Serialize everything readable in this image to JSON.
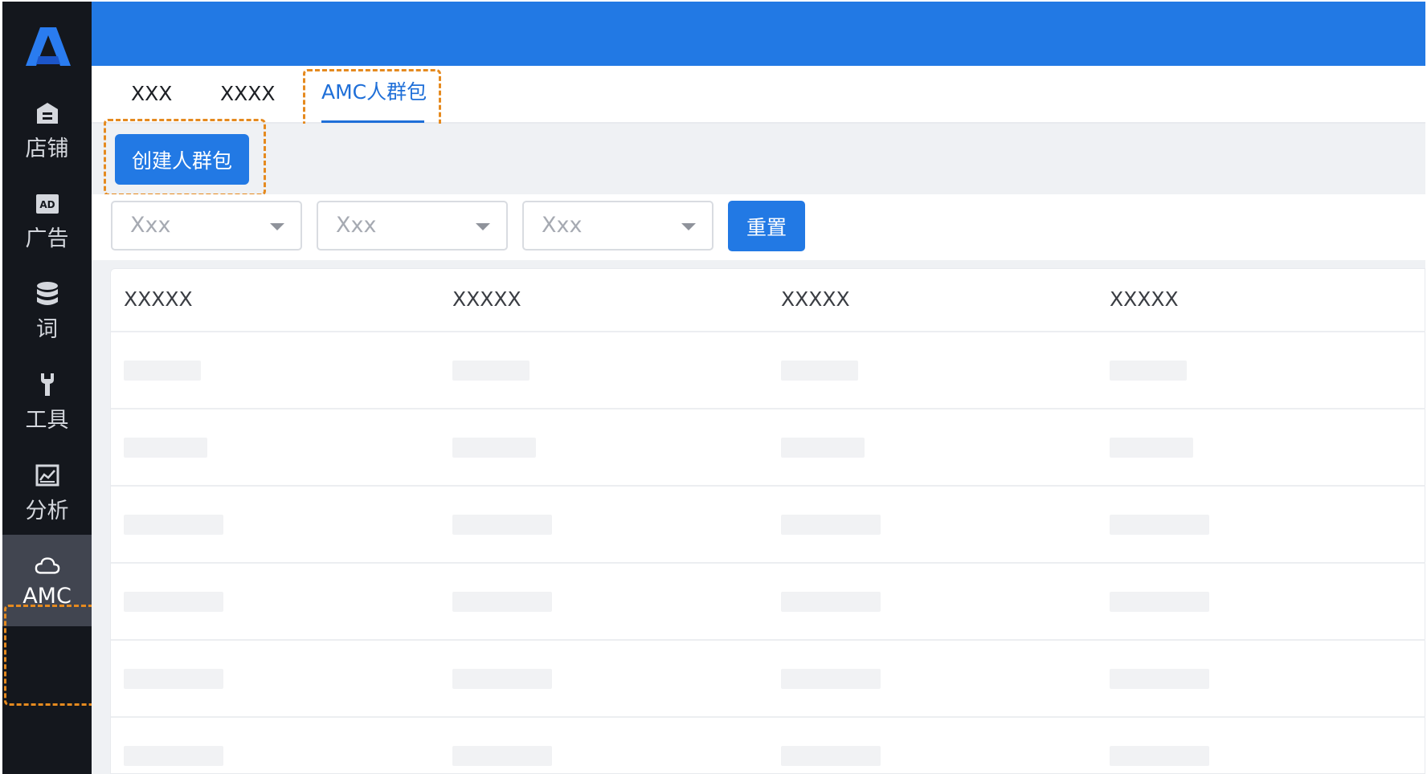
{
  "sidebar": {
    "logo": "brand-logo",
    "items": [
      {
        "label": "店铺",
        "icon": "store-icon"
      },
      {
        "label": "广告",
        "icon": "ad-icon"
      },
      {
        "label": "词",
        "icon": "database-icon"
      },
      {
        "label": "工具",
        "icon": "wrench-icon"
      },
      {
        "label": "分析",
        "icon": "chart-icon"
      },
      {
        "label": "AMC",
        "icon": "cloud-icon",
        "active": true
      }
    ]
  },
  "tabs": [
    {
      "label": "XXX"
    },
    {
      "label": "XXXX"
    },
    {
      "label": "AMC人群包",
      "active": true
    }
  ],
  "toolbar": {
    "create_label": "创建人群包"
  },
  "filters": {
    "selects": [
      {
        "placeholder": "Xxx"
      },
      {
        "placeholder": "Xxx"
      },
      {
        "placeholder": "Xxx"
      }
    ],
    "reset_label": "重置"
  },
  "table": {
    "columns": [
      "XXXXX",
      "XXXXX",
      "XXXXX",
      "XXXXX"
    ],
    "rows_state": "loading-skeleton"
  },
  "colors": {
    "header": "#2279e4",
    "sidebar": "#14171d",
    "accent": "#1f6fd8",
    "highlight": "#e58a1f"
  }
}
